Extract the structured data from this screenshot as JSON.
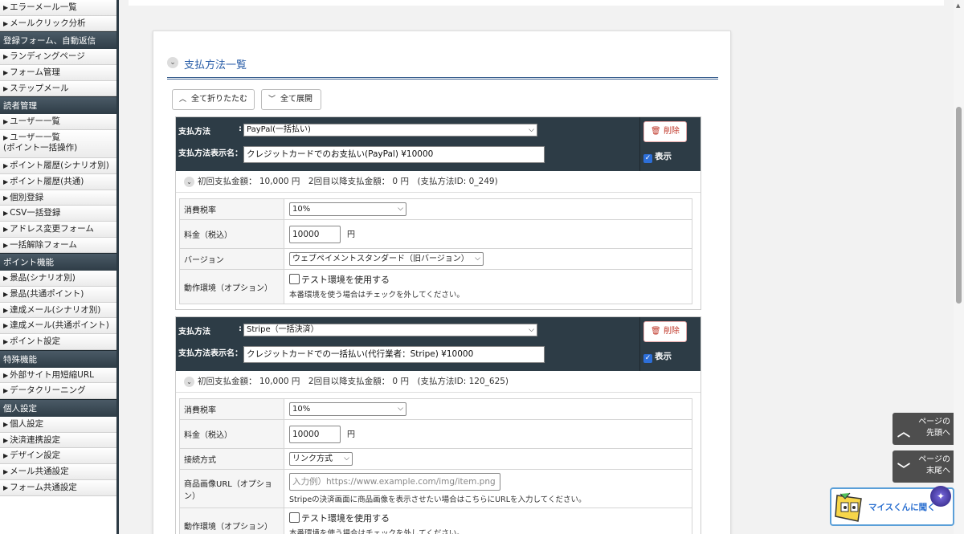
{
  "sidebar": {
    "groups": [
      {
        "header": "",
        "items": [
          "エラーメール一覧",
          "メールクリック分析"
        ]
      },
      {
        "header": "登録フォーム、自動返信",
        "items": [
          "ランディングページ",
          "フォーム管理",
          "ステップメール"
        ]
      },
      {
        "header": "読者管理",
        "items": [
          "ユーザー一覧",
          "ユーザー一覧\n(ポイント一括操作)",
          "ポイント履歴(シナリオ別)",
          "ポイント履歴(共通)",
          "個別登録",
          "CSV一括登録",
          "アドレス変更フォーム",
          "一括解除フォーム"
        ]
      },
      {
        "header": "ポイント機能",
        "items": [
          "景品(シナリオ別)",
          "景品(共通ポイント)",
          "達成メール(シナリオ別)",
          "達成メール(共通ポイント)",
          "ポイント設定"
        ]
      },
      {
        "header": "特殊機能",
        "items": [
          "外部サイト用短縮URL",
          "データクリーニング"
        ]
      },
      {
        "header": "個人設定",
        "items": [
          "個人設定",
          "決済連携設定",
          "デザイン設定",
          "メール共通設定",
          "フォーム共通設定"
        ]
      }
    ]
  },
  "main": {
    "section_title": "支払方法一覧",
    "collapse_all": "全て折りたたむ",
    "expand_all": "全て展開"
  },
  "labels": {
    "method": "支払方法",
    "display_name": "支払方法表示名：",
    "delete": "削除",
    "show": "表示",
    "tax_rate": "消費税率",
    "fee": "料金（税込）",
    "yen": "円",
    "version": "バージョン",
    "env": "動作環境（オプション）",
    "test_env": "テスト環境を使用する",
    "env_note": "本番環境を使う場合はチェックを外してください。",
    "connection": "接続方式",
    "image_url": "商品画像URL（オプション）",
    "image_placeholder": "入力例）https://www.example.com/img/item.png",
    "image_note": "Stripeの決済画面に商品画像を表示させたい場合はこちらにURLを入力してください。"
  },
  "cards": [
    {
      "method": "PayPal(一括払い)",
      "display_name": "クレジットカードでのお支払い(PayPal) ¥10000",
      "summary": "初回支払金額： 10,000 円　2回目以降支払金額： 0 円　(支払方法ID: 0_249)",
      "tax": "10%",
      "fee": "10000",
      "version": "ウェブペイメントスタンダード（旧バージョン）"
    },
    {
      "method": "Stripe（一括決済）",
      "display_name": "クレジットカードでの一括払い(代行業者：Stripe) ¥10000",
      "summary": "初回支払金額： 10,000 円　2回目以降支払金額： 0 円　(支払方法ID: 120_625)",
      "tax": "10%",
      "fee": "10000",
      "connection": "リンク方式"
    }
  ],
  "float": {
    "top_line1": "ページの",
    "top_line2": "先頭へ",
    "bottom_line1": "ページの",
    "bottom_line2": "末尾へ",
    "mais": "マイスくんに聞く"
  }
}
